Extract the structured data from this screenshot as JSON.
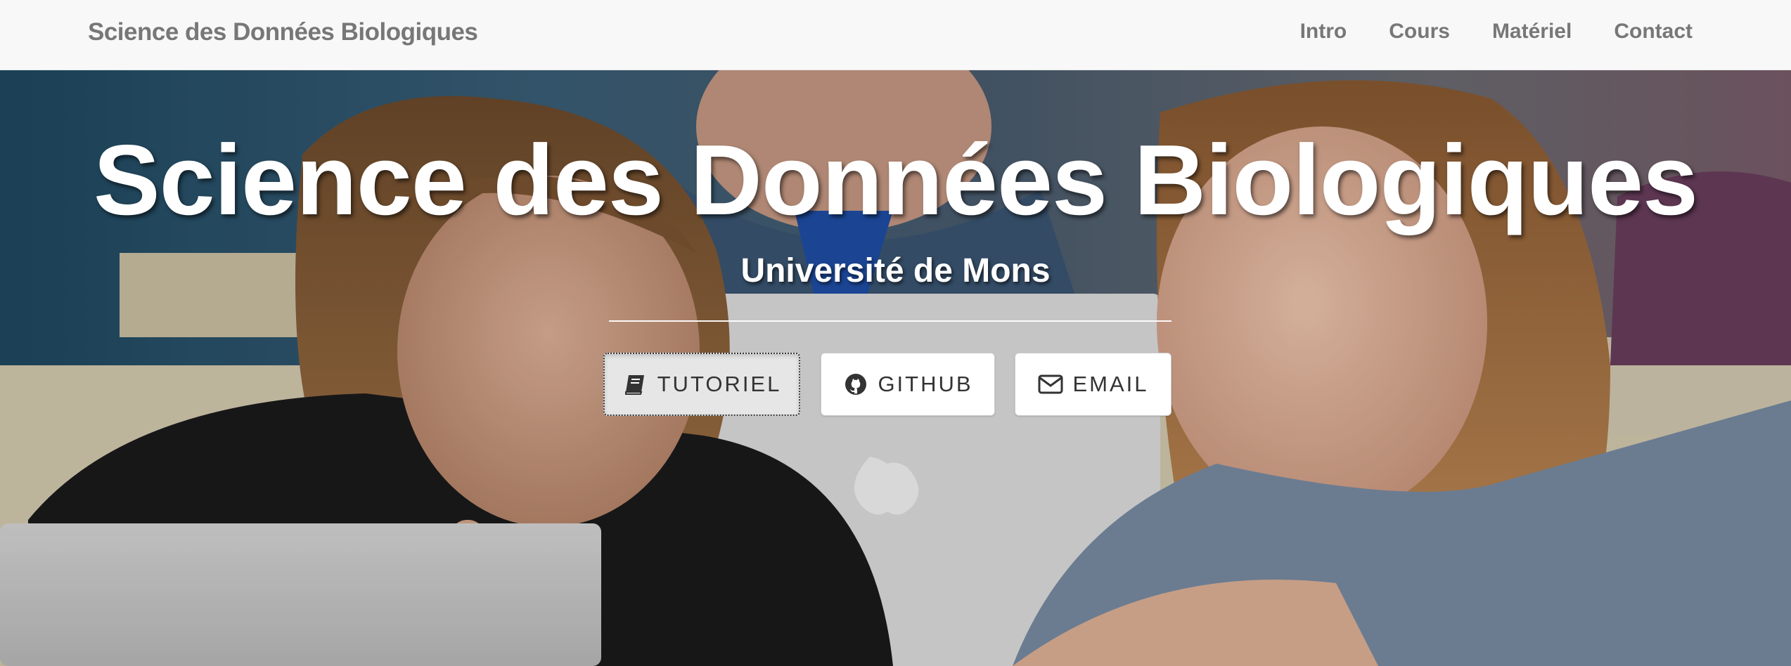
{
  "navbar": {
    "brand": "Science des Données Biologiques",
    "links": [
      "Intro",
      "Cours",
      "Matériel",
      "Contact"
    ]
  },
  "hero": {
    "title": "Science des Données Biologiques",
    "subtitle": "Université de Mons",
    "buttons": [
      {
        "label": "TUTORIEL",
        "icon": "book-icon",
        "state": "focused"
      },
      {
        "label": "GITHUB",
        "icon": "github-icon"
      },
      {
        "label": "EMAIL",
        "icon": "envelope-icon"
      }
    ]
  },
  "colors": {
    "navbar_background": "#f8f8f8",
    "navbar_text": "#777777",
    "hero_text": "#ffffff",
    "button_text": "#333333"
  }
}
